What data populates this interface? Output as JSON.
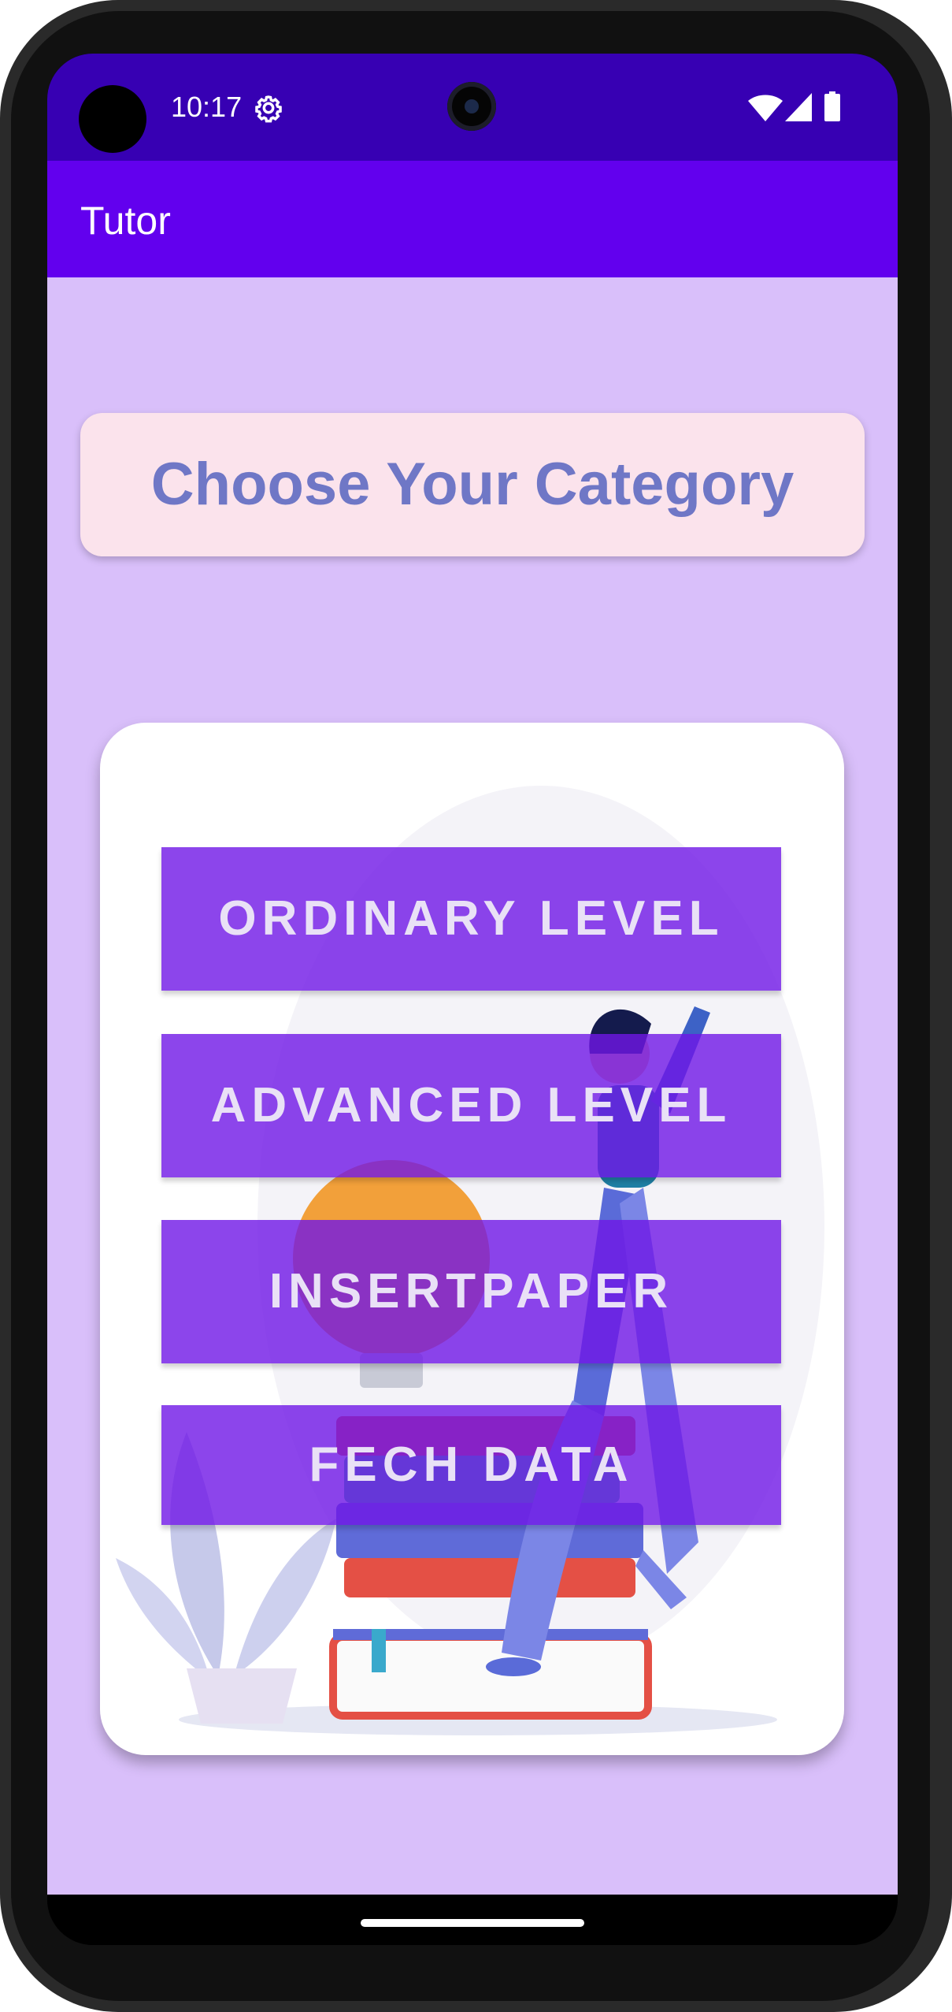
{
  "status_bar": {
    "time": "10:17",
    "icons": [
      "gear-icon",
      "wifi-icon",
      "signal-icon",
      "battery-icon"
    ]
  },
  "app_bar": {
    "title": "Tutor"
  },
  "heading": {
    "text": "Choose Your Category"
  },
  "menu": {
    "buttons": [
      {
        "label": "ORDINARY LEVEL"
      },
      {
        "label": "ADVANCED LEVEL"
      },
      {
        "label": "INSERTPAPER"
      },
      {
        "label": "FECH DATA"
      }
    ]
  },
  "colors": {
    "status_bar": "#3700b3",
    "app_bar": "#6200ee",
    "background": "#d9bffa",
    "heading_card": "#fbe3ec",
    "heading_text": "#6f77c6",
    "button": "#6f16e6",
    "button_text": "#e9e1f6"
  }
}
